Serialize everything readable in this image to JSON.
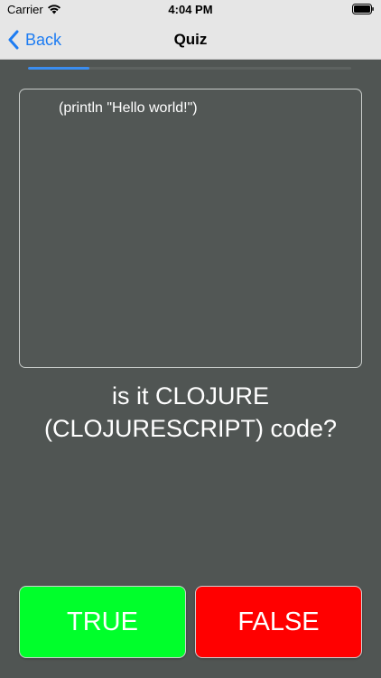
{
  "status_bar": {
    "carrier": "Carrier",
    "time": "4:04 PM"
  },
  "nav": {
    "back_label": "Back",
    "title": "Quiz"
  },
  "progress": {
    "fraction": 0.19
  },
  "code": {
    "text": "(println \"Hello world!\")"
  },
  "question": {
    "line1": "is it CLOJURE",
    "line2": "(CLOJURESCRIPT) code?"
  },
  "answers": {
    "true_label": "TRUE",
    "false_label": "FALSE"
  },
  "colors": {
    "accent": "#1d7cf2",
    "progress": "#3a8df0",
    "true_button": "#00ff2b",
    "false_button": "#ff0000",
    "background": "#505553"
  },
  "icons": {
    "wifi": "wifi-icon",
    "battery": "battery-icon",
    "back": "chevron-left-icon"
  }
}
